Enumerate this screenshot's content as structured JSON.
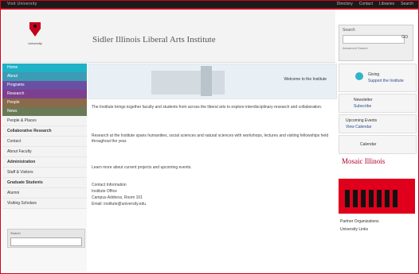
{
  "topbar": {
    "left_link": "Visit University",
    "links": [
      "Directory",
      "Contact",
      "Libraries",
      "Search"
    ]
  },
  "header": {
    "logo_text": "University",
    "site_title": "Sidler Illinois Liberal Arts Institute"
  },
  "search": {
    "label": "Search",
    "placeholder": "",
    "button": "GO",
    "advanced": "Advanced Search"
  },
  "sidebar": {
    "items": [
      {
        "label": "Home",
        "color": "#1fb1c6"
      },
      {
        "label": "About",
        "color": "#3c9bb5"
      },
      {
        "label": "Programs",
        "color": "#6a4fa3"
      },
      {
        "label": "Research",
        "color": "#7d3f8f"
      },
      {
        "label": "People",
        "color": "#8a6a4a"
      },
      {
        "label": "News",
        "color": "#6a7a57"
      }
    ],
    "sub": [
      "People & Places",
      "Collaborative Research",
      "Contact",
      "About Faculty",
      "Administration",
      "Staff & Visitors",
      "Graduate Students",
      "Alumni",
      "Visiting Scholars"
    ],
    "side_search_label": "Search",
    "side_search_placeholder": ""
  },
  "content": {
    "banner_text": "Welcome to the Institute",
    "para1": "The Institute brings together faculty and students from across the liberal arts to explore interdisciplinary research and collaboration.",
    "para2": "Research at the Institute spans humanities, social sciences and natural sciences with workshops, lectures and visiting fellowships held throughout the year.",
    "para3": "Learn more about current projects and upcoming events.",
    "contact_title": "Contact Information",
    "contact_line1": "Institute Office",
    "contact_line2": "Campus Address, Room 101",
    "contact_line3": "Email: institute@university.edu"
  },
  "right": {
    "box1_line1": "Giving",
    "box1_line2": "Support the Institute",
    "box2_line1": "Newsletter",
    "box2_line2": "Subscribe",
    "box3_line1": "Upcoming Events",
    "box3_line2": "View Calendar",
    "box4_line1": "Calendar",
    "banner_script": "Mosaic Illinois",
    "footer_line1": "Partner Organizations",
    "footer_line2": "University Links"
  }
}
